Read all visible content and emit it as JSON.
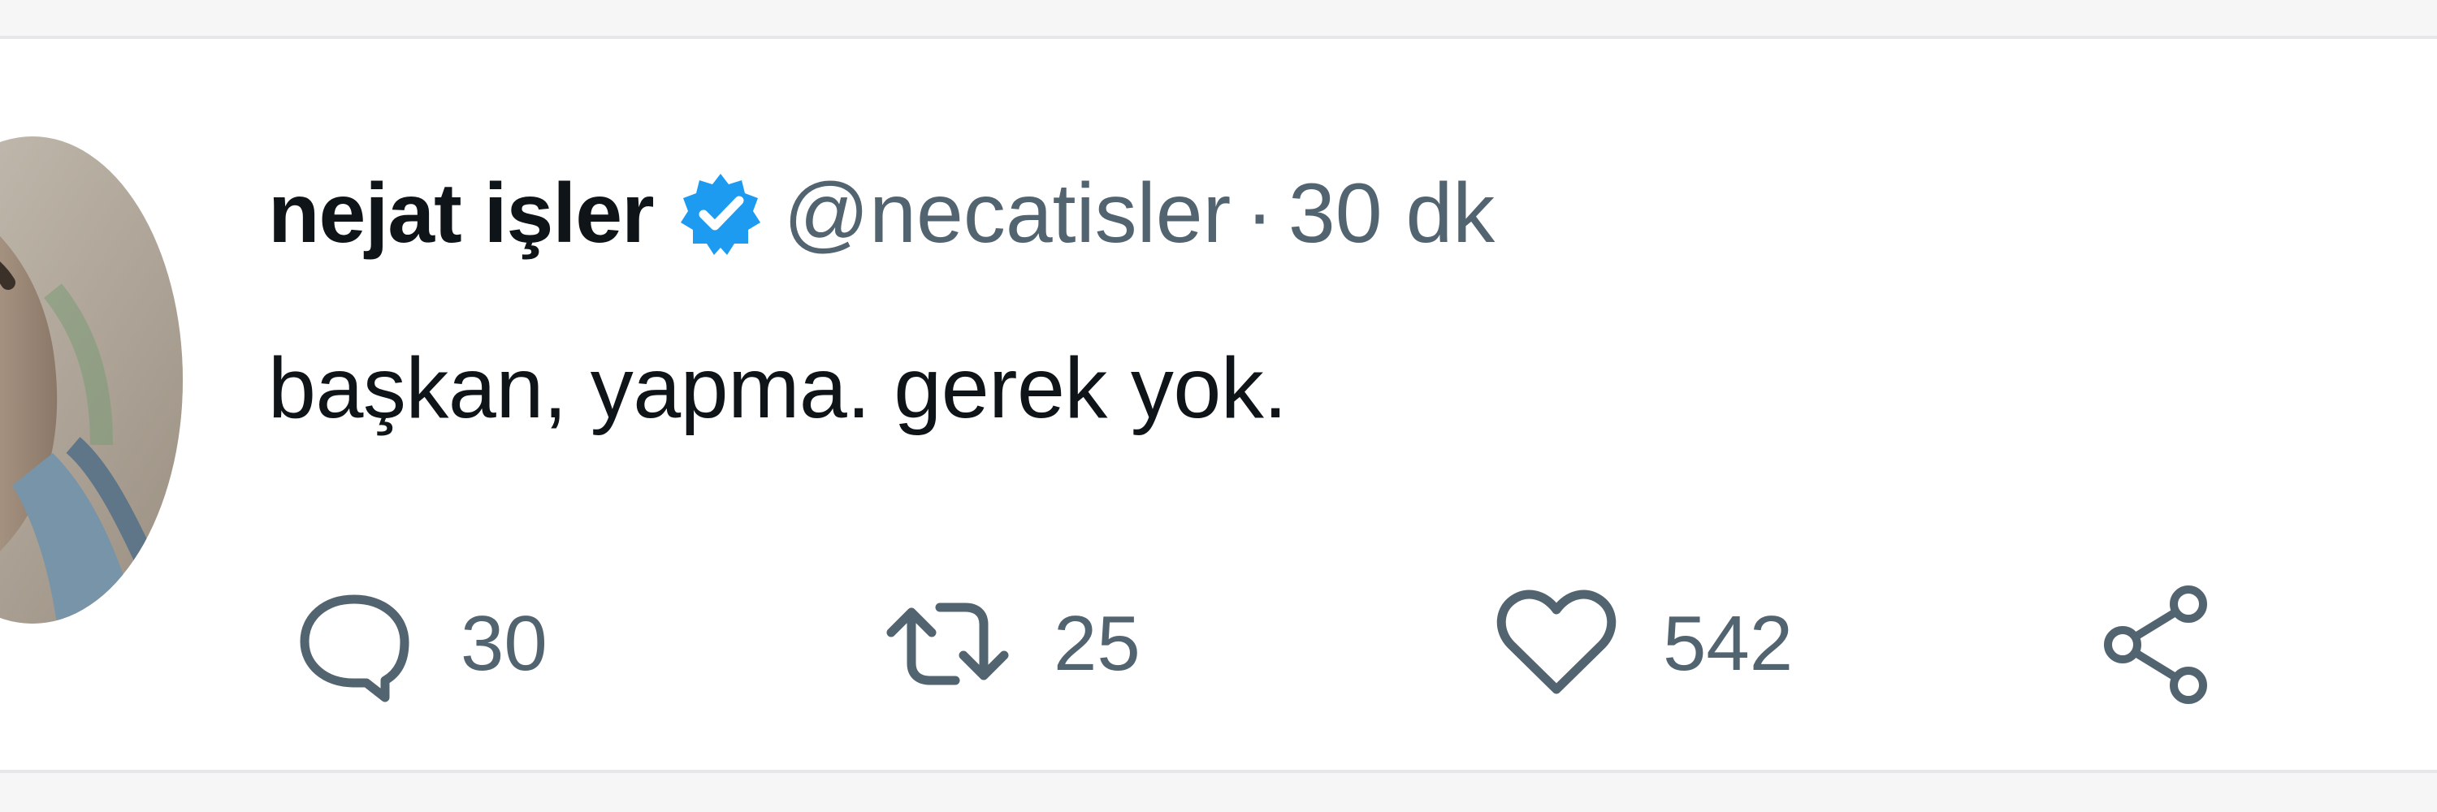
{
  "tweet": {
    "author": {
      "display_name": "nejat işler",
      "handle": "@necatisler",
      "verified": true,
      "verified_icon": "verified-badge-icon",
      "avatar_icon": "profile-photo"
    },
    "timestamp_separator": "·",
    "timestamp": "30 dk",
    "text": "başkan, yapma. gerek yok.",
    "actions": {
      "reply_count": "30",
      "retweet_count": "25",
      "like_count": "542",
      "icons": [
        "reply-icon",
        "retweet-icon",
        "like-icon",
        "share-icon"
      ]
    }
  },
  "colors": {
    "primary_text": "#0f1419",
    "secondary_text": "#536471",
    "verified_blue": "#1d9bf0",
    "divider": "#e7e7e9"
  }
}
